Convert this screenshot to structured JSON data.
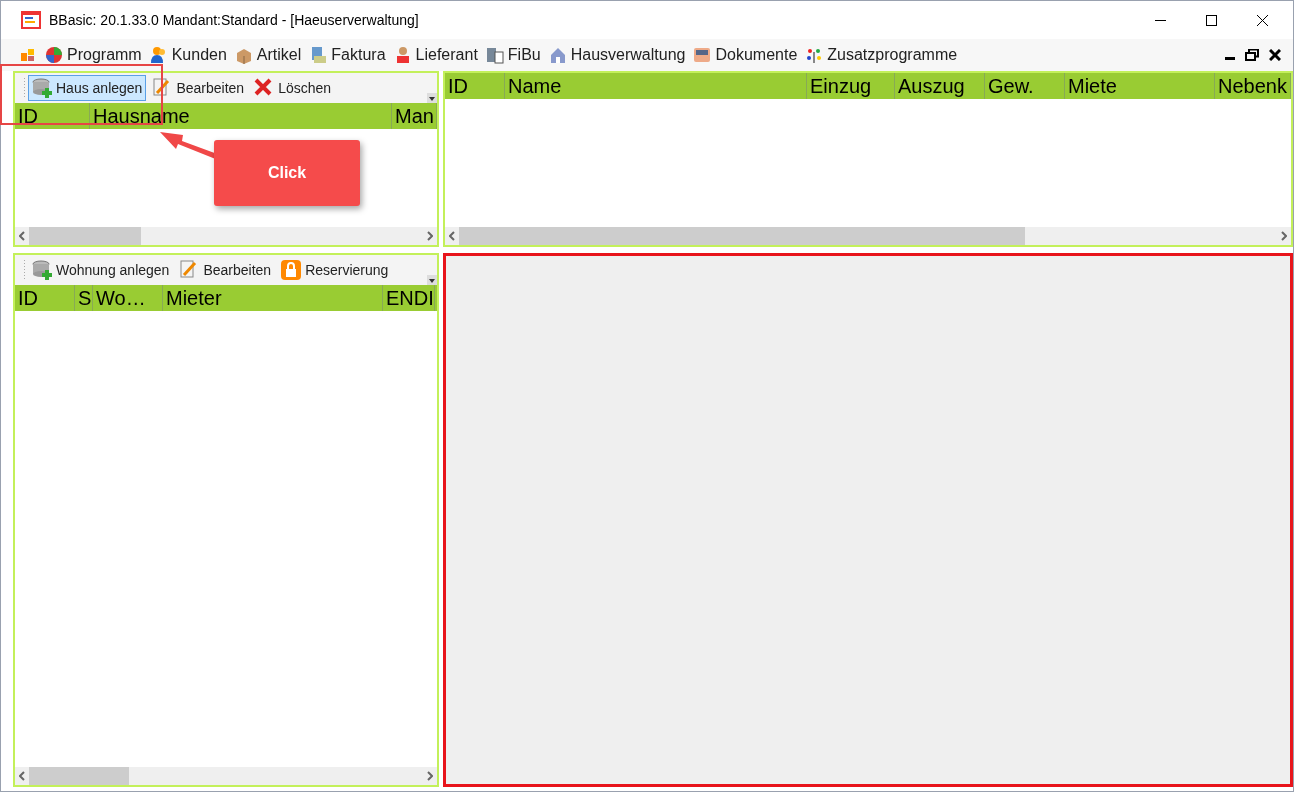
{
  "window": {
    "title": "BBasic: 20.1.33.0 Mandant:Standard  - [Haeuserverwaltung]"
  },
  "menu": [
    {
      "label": "Programm"
    },
    {
      "label": "Kunden"
    },
    {
      "label": "Artikel"
    },
    {
      "label": "Faktura"
    },
    {
      "label": "Lieferant"
    },
    {
      "label": "FiBu"
    },
    {
      "label": "Hausverwaltung"
    },
    {
      "label": "Dokumente"
    },
    {
      "label": "Zusatzprogramme"
    }
  ],
  "houses": {
    "toolbar": [
      {
        "label": "Haus anlegen",
        "selected": true
      },
      {
        "label": "Bearbeiten",
        "selected": false
      },
      {
        "label": "Löschen",
        "selected": false
      }
    ],
    "columns": [
      "ID",
      "Hausname",
      "Man"
    ]
  },
  "tenants": {
    "columns": [
      "ID",
      "Name",
      "Einzug",
      "Auszug",
      "Gew.",
      "Miete",
      "Nebenk"
    ]
  },
  "apartments": {
    "toolbar": [
      {
        "label": "Wohnung anlegen",
        "selected": false
      },
      {
        "label": "Bearbeiten",
        "selected": false
      },
      {
        "label": "Reservierung",
        "selected": false
      }
    ],
    "columns": [
      "ID",
      "S",
      "Wo…",
      "Mieter",
      "ENDI"
    ]
  },
  "callout": {
    "label": "Click"
  }
}
